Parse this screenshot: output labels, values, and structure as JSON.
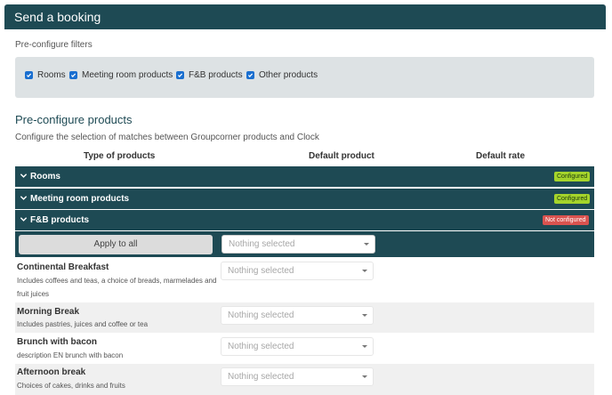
{
  "header": {
    "title": "Send a booking"
  },
  "filters": {
    "label": "Pre-configure filters",
    "items": [
      {
        "label": "Rooms",
        "checked": true
      },
      {
        "label": "Meeting room products",
        "checked": true
      },
      {
        "label": "F&B products",
        "checked": true
      },
      {
        "label": "Other products",
        "checked": true
      }
    ]
  },
  "products_section": {
    "title": "Pre-configure products",
    "description": "Configure the selection of matches between Groupcorner products and Clock",
    "columns": [
      "Type of products",
      "Default product",
      "Default rate"
    ]
  },
  "categories": [
    {
      "label": "Rooms",
      "status": "Configured",
      "status_color": "#a5d42b"
    },
    {
      "label": "Meeting room products",
      "status": "Configured",
      "status_color": "#a5d42b"
    },
    {
      "label": "F&B products",
      "status": "Not configured",
      "status_color": "#d9534f"
    }
  ],
  "apply": {
    "button_label": "Apply to all",
    "select_placeholder": "Nothing selected"
  },
  "products": [
    {
      "name": "Continental Breakfast",
      "description": "Includes coffees and teas, a choice of breads, marmelades and fruit juices",
      "select": "Nothing selected"
    },
    {
      "name": "Morning Break",
      "description": "Includes pastries, juices and coffee or tea",
      "select": "Nothing selected"
    },
    {
      "name": "Brunch with bacon",
      "description": "description EN brunch with bacon",
      "select": "Nothing selected"
    },
    {
      "name": "Afternoon break",
      "description": "Choices of cakes, drinks and fruits",
      "select": "Nothing selected"
    }
  ],
  "colors": {
    "header": "#1e4a54",
    "checkbox": "#1a6fd0",
    "configured": "#a5d42b",
    "not_configured": "#d9534f"
  }
}
